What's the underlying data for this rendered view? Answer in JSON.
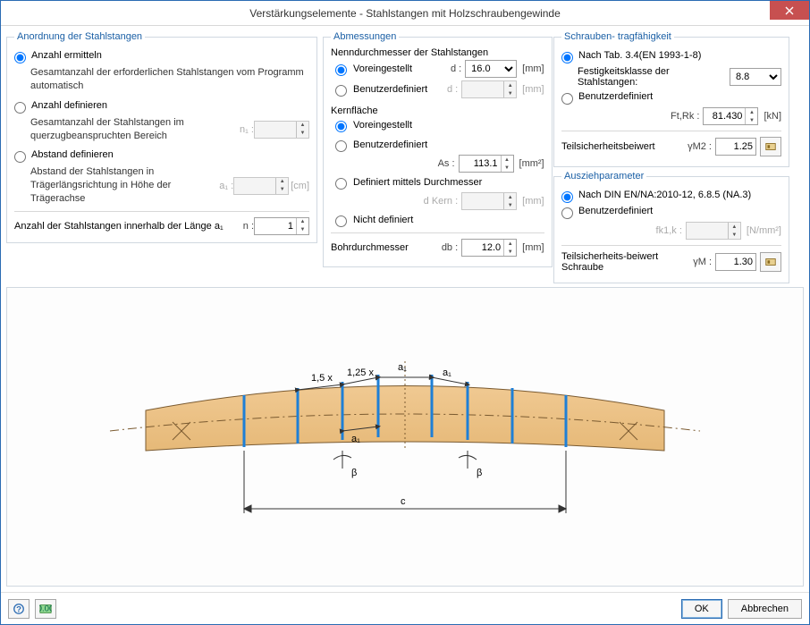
{
  "title": "Verstärkungselemente - Stahlstangen mit Holzschraubengewinde",
  "arrangement": {
    "legend": "Anordnung der Stahlstangen",
    "opt1": {
      "label": "Anzahl ermitteln",
      "sub": "Gesamtanzahl der erforderlichen Stahlstangen vom Programm automatisch"
    },
    "opt2": {
      "label": "Anzahl definieren",
      "sub": "Gesamtanzahl der Stahlstangen im querzugbeanspruchten Bereich",
      "sym": "n₁ :"
    },
    "opt3": {
      "label": "Abstand definieren",
      "sub": "Abstand der Stahlstangen in Trägerlängsrichtung in Höhe der Trägerachse",
      "sym": "a₁ :",
      "unit": "[cm]"
    },
    "count_label": "Anzahl der Stahlstangen innerhalb der Länge a₁",
    "count_sym": "n :",
    "count_val": "1"
  },
  "dimensions": {
    "legend": "Abmessungen",
    "nominal_header": "Nenndurchmesser der Stahlstangen",
    "preset": "Voreingestellt",
    "user": "Benutzerdefiniert",
    "d_sym": "d :",
    "d_val": "16.0",
    "core_header": "Kernfläche",
    "as_sym": "As :",
    "as_val": "113.1",
    "def_by_diam": "Definiert mittels Durchmesser",
    "dkern_sym": "d Kern :",
    "notdef": "Nicht definiert",
    "bore_label": "Bohrdurchmesser",
    "db_sym": "db :",
    "db_val": "12.0",
    "mm": "[mm]",
    "mm2": "[mm²]"
  },
  "screw": {
    "legend": "Schrauben- tragfähigkeit",
    "std": "Nach Tab. 3.4(EN 1993-1-8)",
    "strength_label": "Festigkeitsklasse der Stahlstangen:",
    "strength_val": "8.8",
    "user": "Benutzerdefiniert",
    "ftrk_sym": "Ft,Rk :",
    "ftrk_val": "81.430",
    "kn": "[kN]",
    "safety_label": "Teilsicherheitsbeiwert",
    "safety_sym": "γM2 :",
    "safety_val": "1.25"
  },
  "pullout": {
    "legend": "Ausziehparameter",
    "std": "Nach DIN EN/NA:2010-12, 6.8.5 (NA.3)",
    "user": "Benutzerdefiniert",
    "fk_sym": "fk1,k :",
    "fk_unit": "[N/mm²]",
    "safety_label": "Teilsicherheits-beiwert Schraube",
    "safety_sym": "γM :",
    "safety_val": "1.30"
  },
  "buttons": {
    "ok": "OK",
    "cancel": "Abbrechen"
  },
  "diagram": {
    "labels": {
      "a1": "a₁",
      "m15": "1,5 x",
      "m125": "1,25 x",
      "beta": "β",
      "c": "c"
    }
  }
}
